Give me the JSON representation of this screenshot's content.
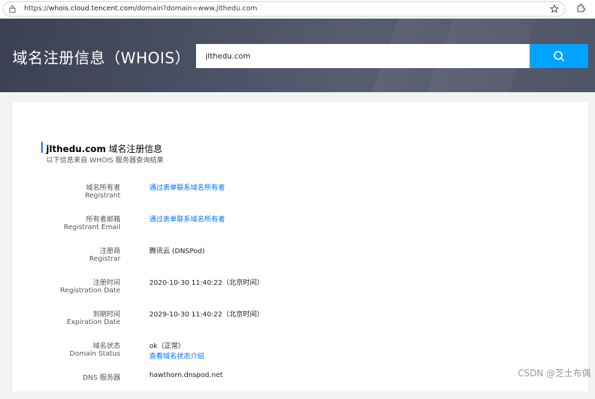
{
  "browser": {
    "url_prefix": "https://",
    "url_host": "whois.cloud.tencent.com",
    "url_path": "/domain?domain=www.jlthedu.com"
  },
  "banner": {
    "title": "域名注册信息（WHOIS）",
    "search_value": "jlthedu.com",
    "accent_color": "#00a4ff"
  },
  "section": {
    "domain": "jlthedu.com",
    "title_suffix": " 域名注册信息",
    "subtitle": "以下信息来自 WHOIS 服务器查询结果"
  },
  "rows": [
    {
      "label_cn": "域名所有者",
      "label_en": "Registrant",
      "value": "通过表单联系域名所有者",
      "value_is_link": true
    },
    {
      "label_cn": "所有者邮箱",
      "label_en": "Registrant Email",
      "value": "通过表单联系域名所有者",
      "value_is_link": true
    },
    {
      "label_cn": "注册商",
      "label_en": "Registrar",
      "value": "腾讯云 (DNSPod)",
      "value_is_link": false
    },
    {
      "label_cn": "注册时间",
      "label_en": "Registration Date",
      "value": "2020-10-30 11:40:22（北京时间）",
      "value_is_link": false
    },
    {
      "label_cn": "到期时间",
      "label_en": "Expiration Date",
      "value": "2029-10-30 11:40:22（北京时间）",
      "value_is_link": false
    },
    {
      "label_cn": "域名状态",
      "label_en": "Domain Status",
      "value": "ok（正常）",
      "value_is_link": false,
      "extra_link": "查看域名状态介绍"
    },
    {
      "label_cn": "DNS 服务器",
      "label_en": "",
      "value": "hawthorn.dnspod.net",
      "value_is_link": false
    }
  ],
  "watermark": "CSDN @芝士布偶",
  "icons": [
    "lock-icon",
    "star-icon",
    "extension-icon",
    "search-icon"
  ]
}
